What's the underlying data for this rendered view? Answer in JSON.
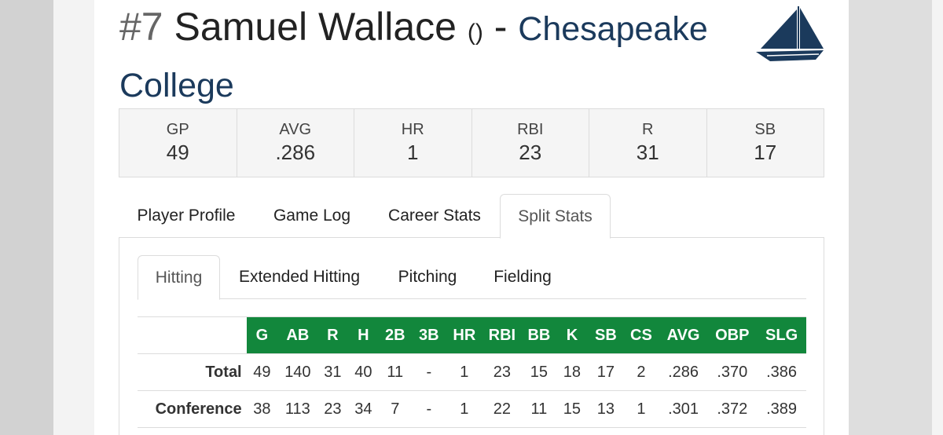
{
  "header": {
    "number": "#7",
    "player_name": "Samuel Wallace",
    "paren": "()",
    "dash": "-",
    "team": "Chesapeake College",
    "logo_icon": "sailboat-icon",
    "brand_color": "#1b3a5c"
  },
  "summary": [
    {
      "label": "GP",
      "value": "49"
    },
    {
      "label": "AVG",
      "value": ".286"
    },
    {
      "label": "HR",
      "value": "1"
    },
    {
      "label": "RBI",
      "value": "23"
    },
    {
      "label": "R",
      "value": "31"
    },
    {
      "label": "SB",
      "value": "17"
    }
  ],
  "tabs": [
    {
      "label": "Player Profile",
      "active": false
    },
    {
      "label": "Game Log",
      "active": false
    },
    {
      "label": "Career Stats",
      "active": false
    },
    {
      "label": "Split Stats",
      "active": true
    }
  ],
  "subtabs": [
    {
      "label": "Hitting",
      "active": true
    },
    {
      "label": "Extended Hitting",
      "active": false
    },
    {
      "label": "Pitching",
      "active": false
    },
    {
      "label": "Fielding",
      "active": false
    }
  ],
  "table": {
    "header_color": "#12873c",
    "columns": [
      "G",
      "AB",
      "R",
      "H",
      "2B",
      "3B",
      "HR",
      "RBI",
      "BB",
      "K",
      "SB",
      "CS",
      "AVG",
      "OBP",
      "SLG"
    ],
    "rows": [
      {
        "label": "Total",
        "cells": [
          "49",
          "140",
          "31",
          "40",
          "11",
          "-",
          "1",
          "23",
          "15",
          "18",
          "17",
          "2",
          ".286",
          ".370",
          ".386"
        ]
      },
      {
        "label": "Conference",
        "cells": [
          "38",
          "113",
          "23",
          "34",
          "7",
          "-",
          "1",
          "22",
          "11",
          "15",
          "13",
          "1",
          ".301",
          ".372",
          ".389"
        ]
      }
    ]
  }
}
